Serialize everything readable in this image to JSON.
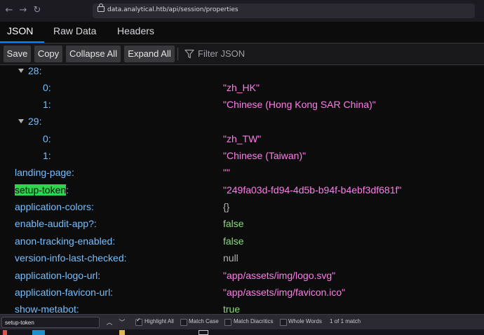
{
  "browser": {
    "url": "data.analytical.htb/api/session/properties"
  },
  "tabs": [
    {
      "label": "JSON",
      "active": true
    },
    {
      "label": "Raw Data",
      "active": false
    },
    {
      "label": "Headers",
      "active": false
    }
  ],
  "toolbar": {
    "save": "Save",
    "copy": "Copy",
    "collapse_all": "Collapse All",
    "expand_all": "Expand All",
    "filter_placeholder": "Filter JSON"
  },
  "tree": {
    "rows": [
      {
        "key": "28:",
        "value": "",
        "type": "node"
      },
      {
        "key": "0:",
        "value": "\"zh_HK\"",
        "type": "string"
      },
      {
        "key": "1:",
        "value": "\"Chinese (Hong Kong SAR China)\"",
        "type": "string"
      },
      {
        "key": "29:",
        "value": "",
        "type": "node"
      },
      {
        "key": "0:",
        "value": "\"zh_TW\"",
        "type": "string"
      },
      {
        "key": "1:",
        "value": "\"Chinese (Taiwan)\"",
        "type": "string"
      },
      {
        "key": "landing-page:",
        "value": "\"\"",
        "type": "string"
      },
      {
        "key": "setup-token",
        "key_suffix": ":",
        "value": "\"249fa03d-fd94-4d5b-b94f-b4ebf3df681f\"",
        "type": "string"
      },
      {
        "key": "application-colors:",
        "value": "{}",
        "type": "obj"
      },
      {
        "key": "enable-audit-app?:",
        "value": "false",
        "type": "bool"
      },
      {
        "key": "anon-tracking-enabled:",
        "value": "false",
        "type": "bool"
      },
      {
        "key": "version-info-last-checked:",
        "value": "null",
        "type": "null"
      },
      {
        "key": "application-logo-url:",
        "value": "\"app/assets/img/logo.svg\"",
        "type": "string"
      },
      {
        "key": "application-favicon-url:",
        "value": "\"app/assets/img/favicon.ico\"",
        "type": "string"
      },
      {
        "key": "show-metabot:",
        "value": "true",
        "type": "bool"
      }
    ]
  },
  "findbar": {
    "query": "setup-token",
    "highlight_all": "Highlight All",
    "match_case": "Match Case",
    "match_diacritics": "Match Diacritics",
    "whole_words": "Whole Words",
    "result": "1 of 1 match"
  },
  "colors": {
    "key": "#75bfff",
    "string": "#ff7de9",
    "bool": "#86de74",
    "null": "#b1b1b3",
    "highlight": "#2ed54d",
    "accent": "#0a84ff"
  }
}
